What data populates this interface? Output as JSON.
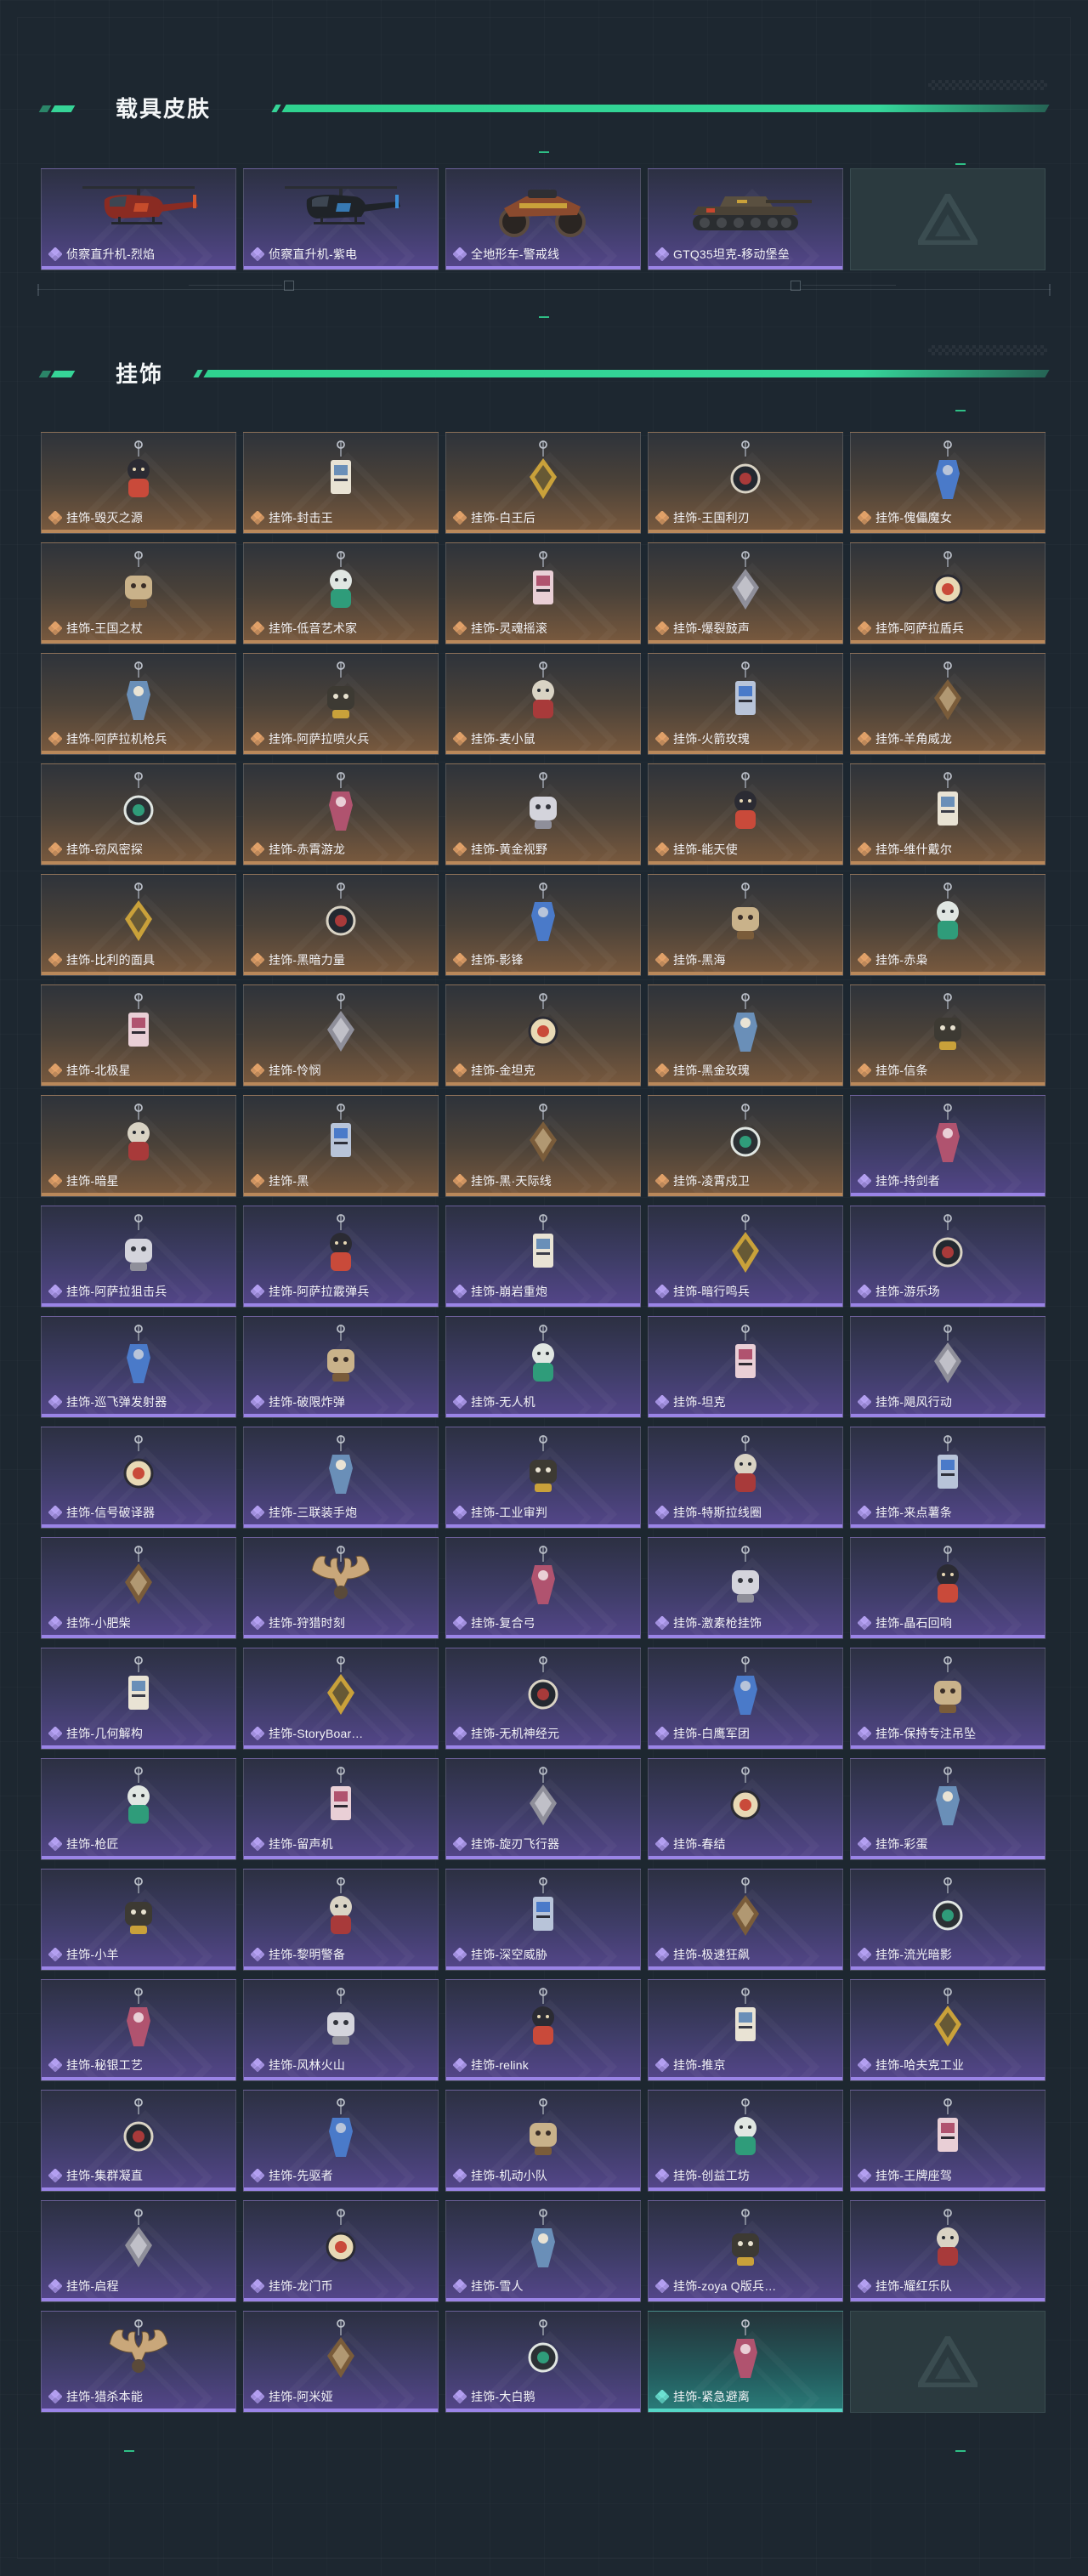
{
  "sections": {
    "vehicles": {
      "title": "载具皮肤",
      "items": [
        {
          "name": "侦察直升机-烈焰",
          "rarity": "purple",
          "icon": "helicopter-red-icon"
        },
        {
          "name": "侦察直升机-紫电",
          "rarity": "purple",
          "icon": "helicopter-black-icon"
        },
        {
          "name": "全地形车-警戒线",
          "rarity": "purple",
          "icon": "atv-icon"
        },
        {
          "name": "GTQ35坦克-移动堡垒",
          "rarity": "purple",
          "icon": "tank-icon"
        },
        {
          "name": "",
          "rarity": "empty",
          "icon": "placeholder-logo-icon"
        }
      ]
    },
    "charms": {
      "title": "挂饰",
      "items": [
        {
          "name": "挂饰-毁灭之源",
          "rarity": "orange"
        },
        {
          "name": "挂饰-封击王",
          "rarity": "orange"
        },
        {
          "name": "挂饰-白王后",
          "rarity": "orange"
        },
        {
          "name": "挂饰-王国利刃",
          "rarity": "orange"
        },
        {
          "name": "挂饰-傀儡魔女",
          "rarity": "orange"
        },
        {
          "name": "挂饰-王国之杖",
          "rarity": "orange"
        },
        {
          "name": "挂饰-低音艺术家",
          "rarity": "orange"
        },
        {
          "name": "挂饰-灵魂摇滚",
          "rarity": "orange"
        },
        {
          "name": "挂饰-爆裂鼓声",
          "rarity": "orange"
        },
        {
          "name": "挂饰-阿萨拉盾兵",
          "rarity": "orange"
        },
        {
          "name": "挂饰-阿萨拉机枪兵",
          "rarity": "orange"
        },
        {
          "name": "挂饰-阿萨拉喷火兵",
          "rarity": "orange"
        },
        {
          "name": "挂饰-麦小鼠",
          "rarity": "orange"
        },
        {
          "name": "挂饰-火箭玫瑰",
          "rarity": "orange"
        },
        {
          "name": "挂饰-羊角威龙",
          "rarity": "orange"
        },
        {
          "name": "挂饰-窃风密探",
          "rarity": "orange"
        },
        {
          "name": "挂饰-赤霄游龙",
          "rarity": "orange"
        },
        {
          "name": "挂饰-黄金视野",
          "rarity": "orange"
        },
        {
          "name": "挂饰-能天使",
          "rarity": "orange"
        },
        {
          "name": "挂饰-维什戴尔",
          "rarity": "orange"
        },
        {
          "name": "挂饰-比利的面具",
          "rarity": "orange"
        },
        {
          "name": "挂饰-黑暗力量",
          "rarity": "orange"
        },
        {
          "name": "挂饰-影锋",
          "rarity": "orange"
        },
        {
          "name": "挂饰-黑海",
          "rarity": "orange"
        },
        {
          "name": "挂饰-赤枭",
          "rarity": "orange"
        },
        {
          "name": "挂饰-北极星",
          "rarity": "orange"
        },
        {
          "name": "挂饰-怜悯",
          "rarity": "orange"
        },
        {
          "name": "挂饰-金坦克",
          "rarity": "orange"
        },
        {
          "name": "挂饰-黑金玫瑰",
          "rarity": "orange"
        },
        {
          "name": "挂饰-信条",
          "rarity": "orange"
        },
        {
          "name": "挂饰-暗星",
          "rarity": "orange"
        },
        {
          "name": "挂饰-黑",
          "rarity": "orange"
        },
        {
          "name": "挂饰-黑·天际线",
          "rarity": "orange"
        },
        {
          "name": "挂饰-凌霄戍卫",
          "rarity": "orange"
        },
        {
          "name": "挂饰-持剑者",
          "rarity": "purple"
        },
        {
          "name": "挂饰-阿萨拉狙击兵",
          "rarity": "purple"
        },
        {
          "name": "挂饰-阿萨拉霰弹兵",
          "rarity": "purple"
        },
        {
          "name": "挂饰-崩岩重炮",
          "rarity": "purple"
        },
        {
          "name": "挂饰-暗行鸣兵",
          "rarity": "purple"
        },
        {
          "name": "挂饰-游乐场",
          "rarity": "purple"
        },
        {
          "name": "挂饰-巡飞弹发射器",
          "rarity": "purple"
        },
        {
          "name": "挂饰-破限炸弹",
          "rarity": "purple"
        },
        {
          "name": "挂饰-无人机",
          "rarity": "purple"
        },
        {
          "name": "挂饰-坦克",
          "rarity": "purple"
        },
        {
          "name": "挂饰-飓风行动",
          "rarity": "purple"
        },
        {
          "name": "挂饰-信号破译器",
          "rarity": "purple"
        },
        {
          "name": "挂饰-三联装手炮",
          "rarity": "purple"
        },
        {
          "name": "挂饰-工业审判",
          "rarity": "purple"
        },
        {
          "name": "挂饰-特斯拉线圈",
          "rarity": "purple"
        },
        {
          "name": "挂饰-来点薯条",
          "rarity": "purple"
        },
        {
          "name": "挂饰-小肥柴",
          "rarity": "purple"
        },
        {
          "name": "挂饰-狩猎时刻",
          "rarity": "purple"
        },
        {
          "name": "挂饰-复合弓",
          "rarity": "purple"
        },
        {
          "name": "挂饰-激素枪挂饰",
          "rarity": "purple"
        },
        {
          "name": "挂饰-晶石回响",
          "rarity": "purple"
        },
        {
          "name": "挂饰-几何解构",
          "rarity": "purple"
        },
        {
          "name": "挂饰-StoryBoar…",
          "rarity": "purple"
        },
        {
          "name": "挂饰-无机神经元",
          "rarity": "purple"
        },
        {
          "name": "挂饰-白鹰军团",
          "rarity": "purple"
        },
        {
          "name": "挂饰-保持专注吊坠",
          "rarity": "purple"
        },
        {
          "name": "挂饰-枪匠",
          "rarity": "purple"
        },
        {
          "name": "挂饰-留声机",
          "rarity": "purple"
        },
        {
          "name": "挂饰-旋刃飞行器",
          "rarity": "purple"
        },
        {
          "name": "挂饰-春结",
          "rarity": "purple"
        },
        {
          "name": "挂饰-彩蛋",
          "rarity": "purple"
        },
        {
          "name": "挂饰-小羊",
          "rarity": "purple"
        },
        {
          "name": "挂饰-黎明警备",
          "rarity": "purple"
        },
        {
          "name": "挂饰-深空威胁",
          "rarity": "purple"
        },
        {
          "name": "挂饰-极速狂飙",
          "rarity": "purple"
        },
        {
          "name": "挂饰-流光暗影",
          "rarity": "purple"
        },
        {
          "name": "挂饰-秘银工艺",
          "rarity": "purple"
        },
        {
          "name": "挂饰-风林火山",
          "rarity": "purple"
        },
        {
          "name": "挂饰-relink",
          "rarity": "purple"
        },
        {
          "name": "挂饰-推京",
          "rarity": "purple"
        },
        {
          "name": "挂饰-哈夫克工业",
          "rarity": "purple"
        },
        {
          "name": "挂饰-集群凝直",
          "rarity": "purple"
        },
        {
          "name": "挂饰-先驱者",
          "rarity": "purple"
        },
        {
          "name": "挂饰-机动小队",
          "rarity": "purple"
        },
        {
          "name": "挂饰-创益工坊",
          "rarity": "purple"
        },
        {
          "name": "挂饰-王牌座驾",
          "rarity": "purple"
        },
        {
          "name": "挂饰-启程",
          "rarity": "purple"
        },
        {
          "name": "挂饰-龙门币",
          "rarity": "purple"
        },
        {
          "name": "挂饰-雪人",
          "rarity": "purple"
        },
        {
          "name": "挂饰-zoya Q版兵…",
          "rarity": "purple"
        },
        {
          "name": "挂饰-耀红乐队",
          "rarity": "purple"
        },
        {
          "name": "挂饰-猎杀本能",
          "rarity": "purple"
        },
        {
          "name": "挂饰-阿米娅",
          "rarity": "purple"
        },
        {
          "name": "挂饰-大白鹅",
          "rarity": "purple"
        },
        {
          "name": "挂饰-紧急避离",
          "rarity": "teal"
        },
        {
          "name": "",
          "rarity": "empty"
        }
      ]
    }
  },
  "colors": {
    "accent_green": "#36d497",
    "orange_tier": "#b9885a",
    "purple_tier": "#9a84e6",
    "teal_tier": "#55d6c6"
  }
}
